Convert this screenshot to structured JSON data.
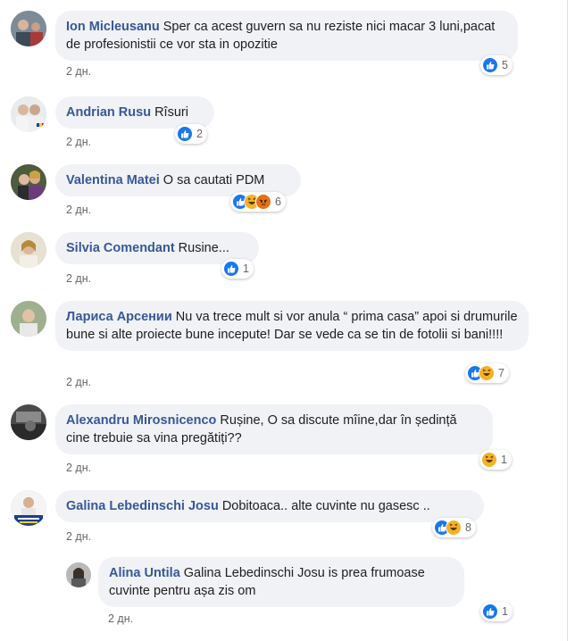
{
  "comments": [
    {
      "name": "Ion Micleusanu",
      "text": "Sper ca acest guvern sa nu reziste nici macar 3 luni,pacat de profesionistii ce vor sta in opozitie",
      "time": "2 дн.",
      "reactions": [
        "like"
      ],
      "count": "5"
    },
    {
      "name": "Andrian Rusu",
      "text": "Rîsuri",
      "time": "2 дн.",
      "reactions": [
        "like"
      ],
      "count": "2"
    },
    {
      "name": "Valentina Matei",
      "text": "O sa cautati PDM",
      "time": "2 дн.",
      "reactions": [
        "like",
        "haha",
        "angry"
      ],
      "count": "6"
    },
    {
      "name": "Silvia Comendant",
      "text": "Rusine...",
      "time": "2 дн.",
      "reactions": [
        "like"
      ],
      "count": "1"
    },
    {
      "name": "Лариса Арсении",
      "text": "Nu va trece mult si vor anula “ prima casa” apoi si drumurile bune si alte proiecte bune incepute! Dar se vede ca se tin de fotolii si bani!!!!",
      "time": "2 дн.",
      "reactions": [
        "like",
        "haha"
      ],
      "count": "7"
    },
    {
      "name": "Alexandru Mirosnicenco",
      "text": "Rușine, O sa discute mîine,dar în ședință cine trebuie sa vina pregătiți??",
      "time": "2 дн.",
      "reactions": [
        "haha"
      ],
      "count": "1"
    },
    {
      "name": "Galina Lebedinschi Josu",
      "text": "Dobitoaca.. alte cuvinte nu gasesc ..",
      "time": "2 дн.",
      "reactions": [
        "like",
        "haha"
      ],
      "count": "8"
    }
  ],
  "reply": {
    "name": "Alina Untila",
    "text": "Galina Lebedinschi Josu is prea frumoase cuvinte pentru așa zis om",
    "time": "2 дн.",
    "reactions": [
      "like"
    ],
    "count": "1"
  },
  "colors": {
    "name": "#385898",
    "bubble": "#f0f2f5",
    "like": "#1877f2",
    "haha": "#f7b125",
    "angry": "#e9710f"
  }
}
